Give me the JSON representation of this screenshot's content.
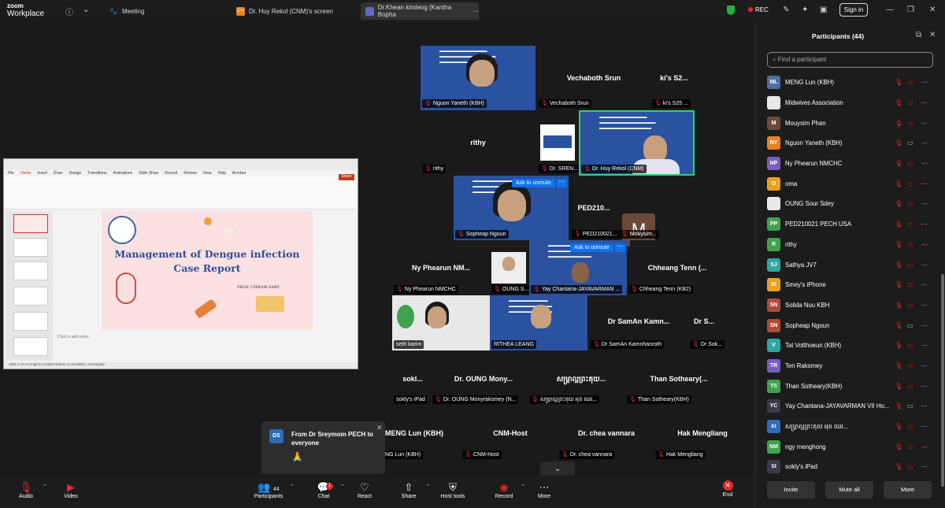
{
  "app": {
    "logo_line1": "zoom",
    "logo_line2": "Workplace"
  },
  "tabs": [
    {
      "label": "Meeting",
      "badge": ""
    },
    {
      "label": "Dr. Huy Rekol (CNM)'s screen",
      "badge": "DH"
    },
    {
      "label": "Dr.Khean kimleng (Kantha Bopha",
      "badge": ""
    }
  ],
  "titlebar": {
    "rec": "REC",
    "signin": "Sign in"
  },
  "slide": {
    "title_line1": "Management of Dengue infection",
    "title_line2": "Case Report",
    "author": "PROF. CHHAM SARY",
    "notes_placeholder": "Click to add notes",
    "ppt_menu": [
      "File",
      "Home",
      "Insert",
      "Draw",
      "Design",
      "Transitions",
      "Animations",
      "Slide Show",
      "Record",
      "Review",
      "View",
      "Help",
      "Acrobat"
    ],
    "share_label": "Share",
    "status": "Slide 1 of 24   English (United States)   Accessibility: Investigate"
  },
  "gallery": {
    "names": {
      "vechaboth": "Vechaboth Srun",
      "kis": "ki's S2...",
      "rithy": "rithy",
      "ped": "PED210...",
      "nyphearun": "Ny Phearun NM...",
      "chheang": "Chheang Tenn (...",
      "samandisplay": "Dr SamAn Kamn...",
      "drs": "Dr S...",
      "sokly": "sokl...",
      "oung": "Dr. OUNG Mony...",
      "khmer": "សម្ព្រាល្អព្រះគុយ...",
      "than": "Than Sotheary(...",
      "menglun": "MENG Lun (KBH)",
      "cnmhost": "CNM-Host",
      "chea": "Dr. chea vannara",
      "hak": "Hak Mengliang"
    },
    "labels": {
      "nguon": "Nguon Yaneth (KBH)",
      "vechaboth": "Vechaboth Srun",
      "kis": "ki's S25 ...",
      "rithy": "rithy",
      "dsren": "Dr. SREN...",
      "huy": "Dr. Huy Rekol (CNM)",
      "sopheap": "Sopheap Ngoun",
      "ped": "PED210021...",
      "mouysim": "Mouysim...",
      "nyphearun": "Ny Phearun NMCHC",
      "oungs": "OUNG S...",
      "yay": "Yay Chantana-JAYAVARMAN ...",
      "chheang": "Chheang Tenn (KB2)",
      "sethkarim": "seth karim",
      "rithea": "RITHEA LEANG",
      "saman": "Dr SamAn Kamnhanroth",
      "drsok": "Dr Sok...",
      "soklyipad": "sokly's iPad",
      "oungmony": "Dr. OUNG Monyraksmey (N...",
      "khmer": "សម្ព្រាល្អព្រះគុយ អុន ឈរ...",
      "than": "Than Sotheary(KBH)",
      "menglun": "NG Lun (KBH)",
      "cnmhost": "CNM-Host",
      "chea": "Dr. chea vannara",
      "hak": "Hak Mengliang"
    },
    "ask_to_unmute": "Ask to unmute",
    "avatar_letter": "M"
  },
  "chat_toast": {
    "initials": "DS",
    "message": "From Dr Sreymom PECH to everyone",
    "emoji": "🙏"
  },
  "toolbar": {
    "audio": "Audio",
    "video": "Video",
    "participants": "Participants",
    "participants_count": "44",
    "chat": "Chat",
    "chat_badge": "1",
    "react": "React",
    "share": "Share",
    "host_tools": "Host tools",
    "record": "Record",
    "more": "More",
    "end": "End"
  },
  "participants_panel": {
    "title": "Participants (44)",
    "search_placeholder": "Find a participant",
    "buttons": {
      "invite": "Invite",
      "mute_all": "Mute all",
      "more": "More"
    },
    "list": [
      {
        "initials": "ML",
        "name": "MENG Lun (KBH)",
        "color": "#4a6fa5",
        "cam": "off"
      },
      {
        "initials": "",
        "name": "Midwives Association",
        "color": "#e8e8e8",
        "cam": "off"
      },
      {
        "initials": "M",
        "name": "Mouysim Phan",
        "color": "#6b4a3a",
        "cam": "off"
      },
      {
        "initials": "NY",
        "name": "Nguon Yaneth (KBH)",
        "color": "#e8821e",
        "cam": "on"
      },
      {
        "initials": "NP",
        "name": "Ny Phearun NMCHC",
        "color": "#7b5bc4",
        "cam": "off"
      },
      {
        "initials": "O",
        "name": "oma",
        "color": "#e8a21e",
        "cam": "off"
      },
      {
        "initials": "",
        "name": "OUNG Sour Sdey",
        "color": "#e8e8e8",
        "cam": "off"
      },
      {
        "initials": "PP",
        "name": "PED210021 PECH USA",
        "color": "#3fa34d",
        "cam": "off"
      },
      {
        "initials": "R",
        "name": "rithy",
        "color": "#3fa34d",
        "cam": "off"
      },
      {
        "initials": "SJ",
        "name": "Sathya JV7",
        "color": "#2fa6a0",
        "cam": "off"
      },
      {
        "initials": "SI",
        "name": "Smey's iPhone",
        "color": "#e8a21e",
        "cam": "off"
      },
      {
        "initials": "SN",
        "name": "Solida Nou KBH",
        "color": "#b24a3a",
        "cam": "off"
      },
      {
        "initials": "SN",
        "name": "Sopheap Ngoun",
        "color": "#b24a3a",
        "cam": "on"
      },
      {
        "initials": "V",
        "name": "Tat Votthoeun (KBH)",
        "color": "#2fa6a0",
        "cam": "off"
      },
      {
        "initials": "TR",
        "name": "Ten Raksmey",
        "color": "#7b5bc4",
        "cam": "off"
      },
      {
        "initials": "TS",
        "name": "Than Sotheary(KBH)",
        "color": "#3fa34d",
        "cam": "off"
      },
      {
        "initials": "YC",
        "name": "Yay Chantana-JAYAVARMAN VII Ho...",
        "color": "#3a3a4a",
        "cam": "on"
      },
      {
        "initials": "ស",
        "name": "សម្ព្រាល្អព្រះគុយ អុន ឈរ...",
        "color": "#2e6bb8",
        "cam": "off"
      },
      {
        "initials": "NM",
        "name": "ngy menghong",
        "color": "#3fa34d",
        "cam": "off"
      },
      {
        "initials": "SI",
        "name": "sokly's iPad",
        "color": "#3a3a4a",
        "cam": "off"
      }
    ]
  }
}
